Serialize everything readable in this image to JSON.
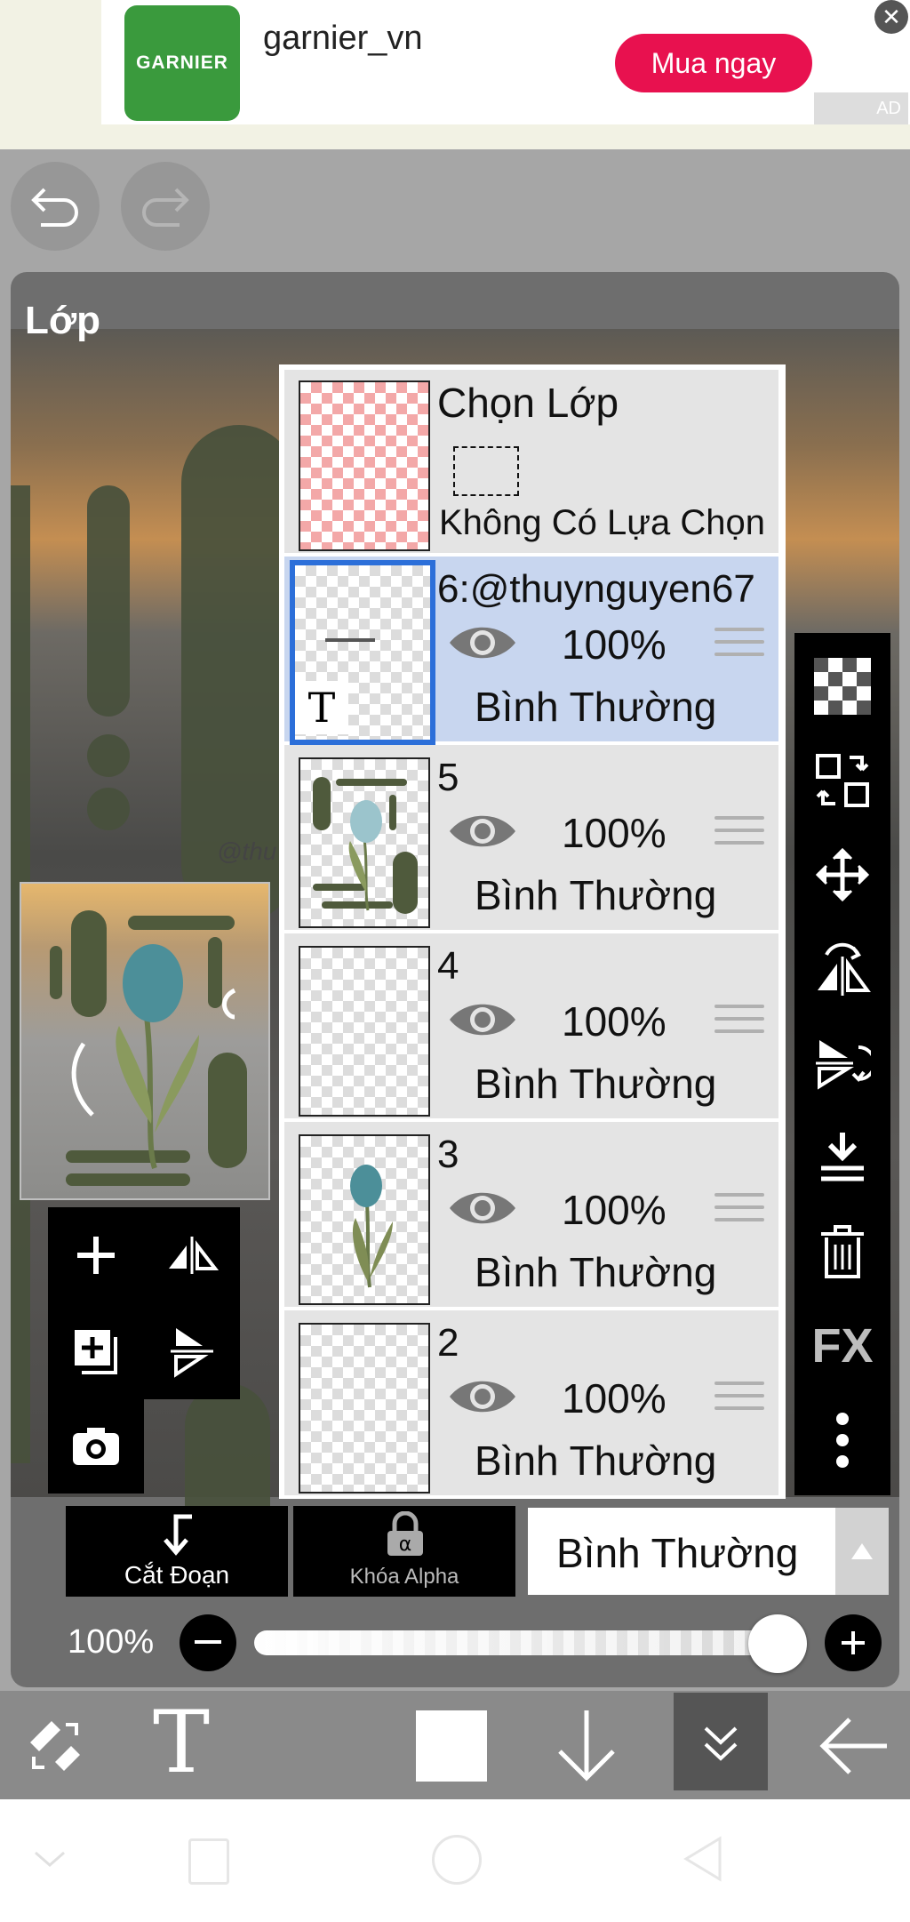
{
  "ad": {
    "brand_logo_text": "GARNIER",
    "account": "garnier_vn",
    "cta": "Mua ngay",
    "badge": "AD"
  },
  "panel": {
    "title": "Lớp"
  },
  "selection_layer": {
    "title": "Chọn Lớp",
    "status": "Không Có Lựa Chọn"
  },
  "layers": [
    {
      "name": "6:@thuynguyen67",
      "opacity": "100%",
      "blend": "Bình Thường",
      "selected": true,
      "type": "text"
    },
    {
      "name": "5",
      "opacity": "100%",
      "blend": "Bình Thường",
      "selected": false
    },
    {
      "name": "4",
      "opacity": "100%",
      "blend": "Bình Thường",
      "selected": false
    },
    {
      "name": "3",
      "opacity": "100%",
      "blend": "Bình Thường",
      "selected": false
    },
    {
      "name": "2",
      "opacity": "100%",
      "blend": "Bình Thường",
      "selected": false
    }
  ],
  "canvas_watermark": "@thu",
  "bottom_controls": {
    "clipping_label": "Cắt Đoạn",
    "alpha_lock_label": "Khóa Alpha",
    "blend_mode": "Bình Thường",
    "opacity_label": "100%",
    "opacity_value": 1.0
  },
  "icons": {
    "undo": "undo-icon",
    "redo": "redo-icon",
    "right_tools": [
      "transparent-checker-icon",
      "swap-layer-icon",
      "move-icon",
      "flip-horizontal-icon",
      "flip-vertical-icon",
      "merge-down-icon",
      "trash-icon",
      "fx-icon",
      "more-icon"
    ],
    "right_tools_fx_label": "FX",
    "left_tools": [
      "add-layer-icon",
      "flip-h-layer-icon",
      "duplicate-layer-icon",
      "flip-v-layer-icon",
      "camera-icon"
    ],
    "bottom_bar": [
      "transform-icon",
      "text-tool-icon",
      "color-swatch",
      "arrow-down-icon",
      "double-chevron-down-icon",
      "back-arrow-icon"
    ],
    "text_tool_glyph": "T",
    "text_layer_badge": "T"
  },
  "colors": {
    "ad_button": "#e8114f",
    "selected_layer": "#c8d6ef",
    "selected_border": "#2c6fd9",
    "brand_green": "#3a9a3d"
  }
}
